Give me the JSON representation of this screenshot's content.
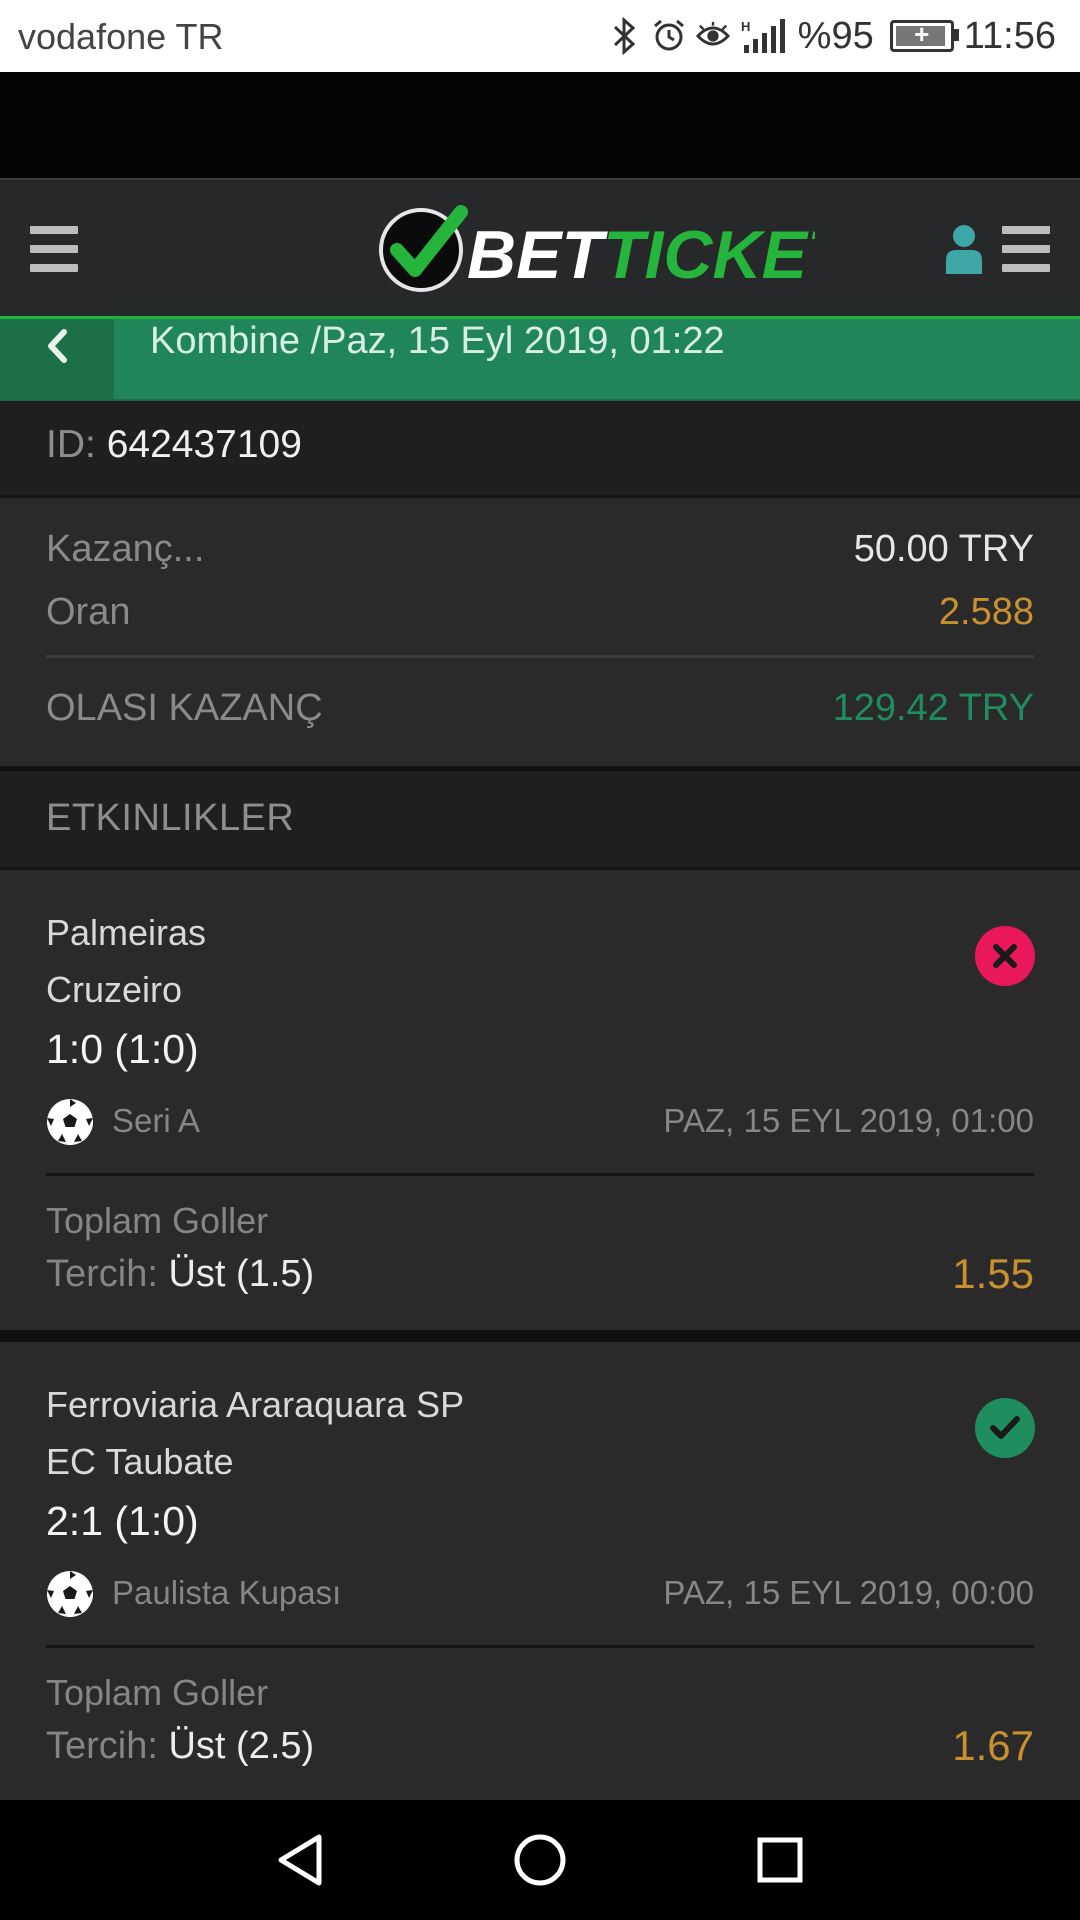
{
  "status_bar": {
    "carrier": "vodafone TR",
    "battery": "%95",
    "battery_level": 0.95,
    "time": "11:56",
    "icons": [
      "bluetooth-icon",
      "alarm-icon",
      "eye-icon",
      "signal-icon",
      "battery-icon"
    ]
  },
  "header": {
    "logo_text_white": "BET",
    "logo_text_green": "TICKET",
    "icons": [
      "menu-icon",
      "user-icon",
      "menu-icon"
    ],
    "accent_color": "#20b23a"
  },
  "breadcrumb": {
    "title": "Kombine /Paz, 15 Eyl 2019, 01:22",
    "bar_color": "#208558"
  },
  "ticket": {
    "id_label": "ID:",
    "id_value": "642437109",
    "stake_label": "Kazanç...",
    "stake_value": "50.00 TRY",
    "odds_label": "Oran",
    "odds_value": "2.588",
    "potential_label": "OLASI KAZANÇ",
    "potential_value": "129.42 TRY",
    "odds_color": "#c9902f",
    "potential_color": "#1f8d5d"
  },
  "events_section": {
    "title": "ETKINLIKLER"
  },
  "events": [
    {
      "home": "Palmeiras",
      "away": "Cruzeiro",
      "score": "1:0 (1:0)",
      "league": "Seri A",
      "date": "PAZ, 15 EYL 2019, 01:00",
      "market": "Toplam Goller",
      "pick_label": "Tercih:",
      "pick_value": "Üst (1.5)",
      "odd": "1.55",
      "status": "lost",
      "status_color": "#e8185a"
    },
    {
      "home": "Ferroviaria Araraquara SP",
      "away": "EC Taubate",
      "score": "2:1 (1:0)",
      "league": "Paulista Kupası",
      "date": "PAZ, 15 EYL 2019, 00:00",
      "market": "Toplam Goller",
      "pick_label": "Tercih:",
      "pick_value": "Üst (2.5)",
      "odd": "1.67",
      "status": "won",
      "status_color": "#1f8d5d"
    }
  ]
}
